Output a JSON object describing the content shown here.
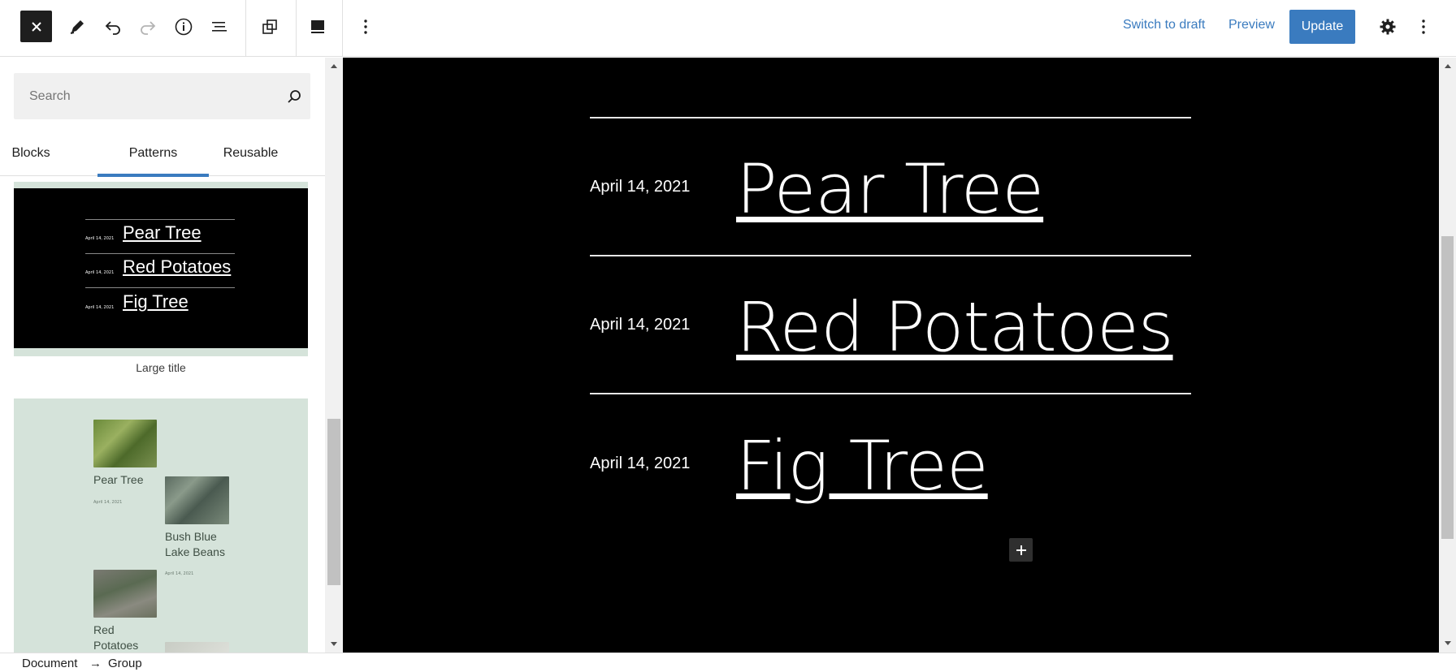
{
  "header": {
    "close_icon": "close-icon",
    "tools": [
      "edit-pencil-icon",
      "undo-icon",
      "redo-icon",
      "info-icon",
      "list-view-icon",
      "block-settings-icon",
      "style-icon",
      "more-vertical-icon"
    ],
    "switch_to_draft": "Switch to draft",
    "preview": "Preview",
    "update": "Update",
    "accent_color": "#3a7bbf"
  },
  "sidebar": {
    "search_placeholder": "Search",
    "tabs": [
      {
        "label": "Blocks",
        "active": false
      },
      {
        "label": "Patterns",
        "active": true
      },
      {
        "label": "Reusable",
        "active": false
      }
    ],
    "pattern1": {
      "label": "Large title",
      "items": [
        {
          "date": "April 14, 2021",
          "title": "Pear Tree"
        },
        {
          "date": "April 14, 2021",
          "title": "Red Potatoes"
        },
        {
          "date": "April 14, 2021",
          "title": "Fig Tree"
        }
      ]
    },
    "pattern2": {
      "items": [
        {
          "name": "Pear Tree",
          "date": "April 14, 2021"
        },
        {
          "name": "Bush Blue Lake Beans",
          "date": "April 14, 2021"
        },
        {
          "name": "Red Potatoes",
          "date": ""
        }
      ]
    }
  },
  "canvas": {
    "posts": [
      {
        "date": "April 14, 2021",
        "title": "Pear Tree"
      },
      {
        "date": "April 14, 2021",
        "title": "Red Potatoes"
      },
      {
        "date": "April 14, 2021",
        "title": "Fig Tree"
      }
    ]
  },
  "footer": {
    "breadcrumb": [
      "Document",
      "Group"
    ],
    "separator": "→"
  }
}
